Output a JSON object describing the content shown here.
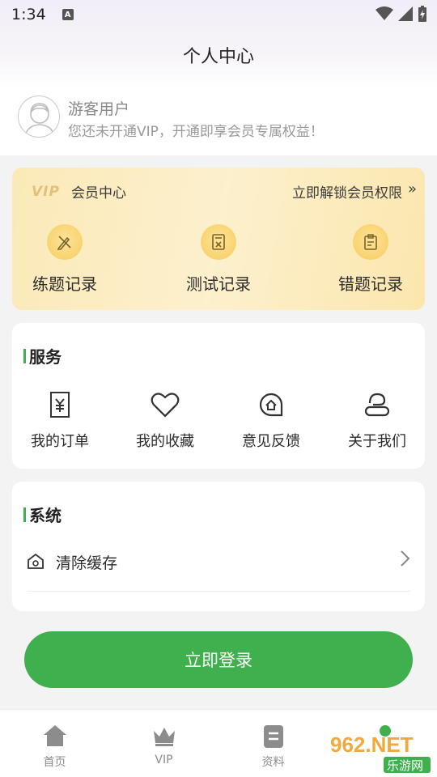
{
  "status_bar": {
    "time": "1:34",
    "notification_icon": "A"
  },
  "header": {
    "title": "个人中心"
  },
  "profile": {
    "name": "游客用户",
    "subtitle": "您还未开通VIP，开通即享会员专属权益！"
  },
  "vip": {
    "logo": "VIP",
    "center_label": "会员中心",
    "unlock_label": "立即解锁会员权限",
    "items": [
      {
        "label": "练题记录",
        "icon": "pencil-ruler-icon"
      },
      {
        "label": "测试记录",
        "icon": "test-paper-icon"
      },
      {
        "label": "错题记录",
        "icon": "clipboard-error-icon"
      }
    ]
  },
  "services": {
    "title": "服务",
    "items": [
      {
        "label": "我的订单",
        "icon": "order-icon"
      },
      {
        "label": "我的收藏",
        "icon": "heart-icon"
      },
      {
        "label": "意见反馈",
        "icon": "feedback-icon"
      },
      {
        "label": "关于我们",
        "icon": "about-icon"
      }
    ]
  },
  "system": {
    "title": "系统",
    "items": [
      {
        "label": "清除缓存",
        "icon": "home-icon"
      }
    ]
  },
  "login_button": "立即登录",
  "tabbar": {
    "items": [
      {
        "label": "首页",
        "icon": "home-icon"
      },
      {
        "label": "VIP",
        "icon": "crown-icon"
      },
      {
        "label": "资料",
        "icon": "document-icon"
      }
    ]
  },
  "watermark": {
    "text_top": "962.NET",
    "text_bottom": "乐游网"
  },
  "colors": {
    "accent": "#3fb04d",
    "vip_bg": "#fbe9b8",
    "vip_icon": "#f8d36f"
  }
}
